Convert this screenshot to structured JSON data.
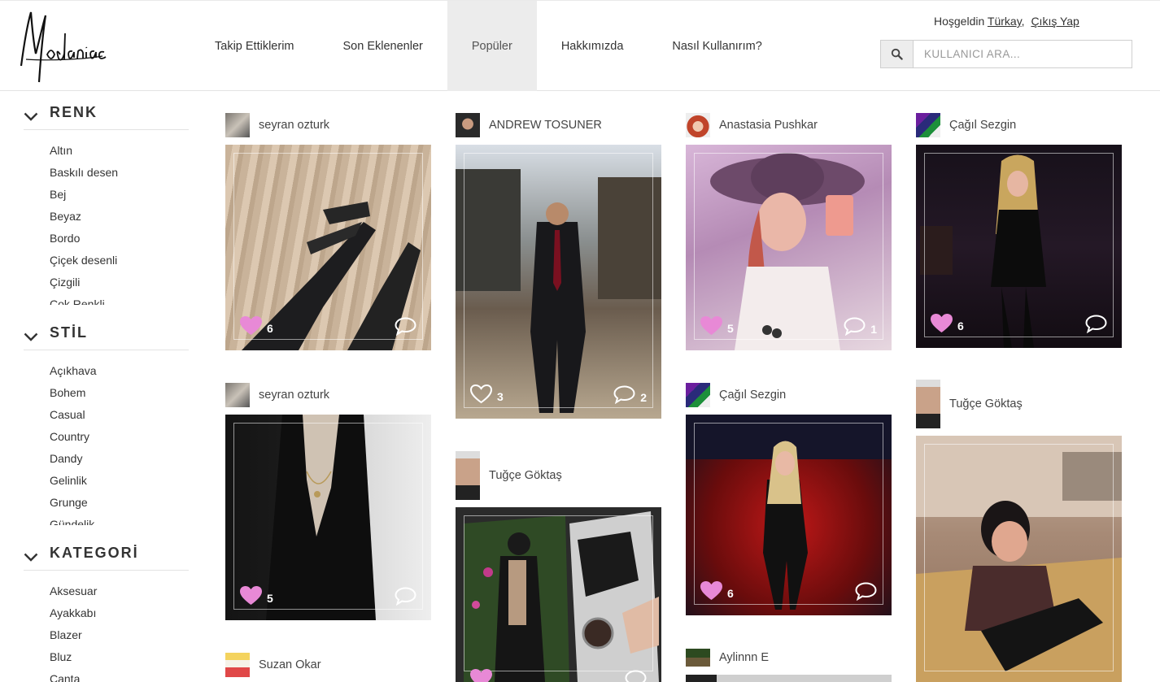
{
  "header": {
    "logo_text": "Modaniac",
    "nav": [
      {
        "label": "Takip Ettiklerim"
      },
      {
        "label": "Son Eklenenler"
      },
      {
        "label": "Popüler",
        "active": true
      },
      {
        "label": "Hakkımızda"
      },
      {
        "label": "Nasıl Kullanırım?"
      }
    ],
    "welcome": "Hoşgeldin",
    "username": "Türkay",
    "separator": ",",
    "logout": "Çıkış Yap",
    "search_placeholder": "KULLANICI ARA..."
  },
  "sidebar": {
    "filters": [
      {
        "title": "RENK",
        "items": [
          "Altın",
          "Baskılı desen",
          "Bej",
          "Beyaz",
          "Bordo",
          "Çiçek desenli",
          "Çizgili",
          "Çok Renkli"
        ]
      },
      {
        "title": "STİL",
        "items": [
          "Açıkhava",
          "Bohem",
          "Casual",
          "Country",
          "Dandy",
          "Gelinlik",
          "Grunge",
          "Gündelik"
        ]
      },
      {
        "title": "KATEGORİ",
        "items": [
          "Aksesuar",
          "Ayakkabı",
          "Blazer",
          "Bluz",
          "Çanta"
        ]
      }
    ]
  },
  "feed": [
    {
      "user": "seyran ozturk",
      "likes": "6",
      "comments": "",
      "liked": true,
      "photo": "black lace-up heels on wooden floor"
    },
    {
      "user": "seyran ozturk",
      "likes": "5",
      "comments": "",
      "liked": true,
      "photo": "black lace outfit with necklaces"
    },
    {
      "user": "Suzan Okar",
      "likes": "",
      "comments": "",
      "liked": false,
      "photo": ""
    },
    {
      "user": "ANDREW TOSUNER",
      "likes": "3",
      "comments": "2",
      "liked": false,
      "photo": "man in suit in hotel lobby"
    },
    {
      "user": "Tuğçe Göktaş",
      "likes": "",
      "comments": "",
      "liked": true,
      "photo": "collage with leather jacket and watch"
    },
    {
      "user": "Anastasia Pushkar",
      "likes": "5",
      "comments": "1",
      "liked": true,
      "photo": "woman in floppy hat mirror selfie"
    },
    {
      "user": "Çağıl Sezgin",
      "likes": "6",
      "comments": "",
      "liked": true,
      "photo": "woman in black dress in red room"
    },
    {
      "user": "Aylinnn E",
      "likes": "",
      "comments": "",
      "liked": false,
      "photo": ""
    },
    {
      "user": "Çağıl Sezgin",
      "likes": "6",
      "comments": "",
      "liked": true,
      "photo": "woman in sequin dress"
    },
    {
      "user": "Tuğçe Göktaş",
      "likes": "",
      "comments": "",
      "liked": false,
      "photo": "woman seated on sofa"
    }
  ],
  "colors": {
    "like_pink": "#e889d6",
    "nav_active_bg": "#ececec",
    "border": "#e3e3e3"
  }
}
